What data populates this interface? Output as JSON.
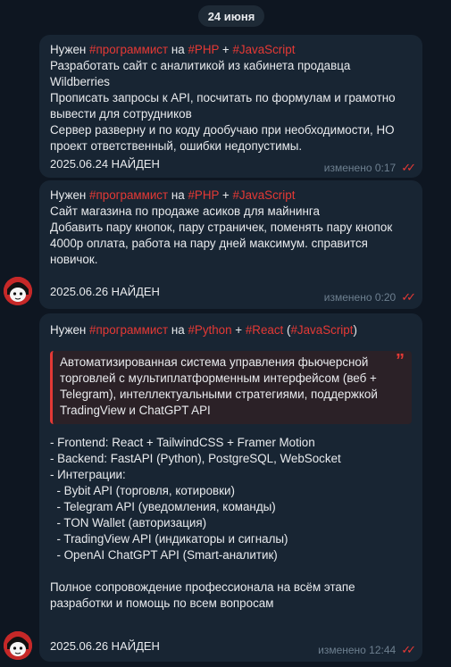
{
  "date_label": "24 июня",
  "messages": [
    {
      "header": {
        "p1": "Нужен ",
        "t1": "#программист",
        "p2": " на ",
        "t2": "#PHP",
        "p3": " + ",
        "t3": "#JavaScript"
      },
      "lines": [
        "Разработать сайт с аналитикой из кабинета продавца Wildberries",
        "Прописать запросы к API, посчитать по формулам и грамотно вывести для сотрудников",
        "Сервер разверну и по коду дообучаю при необходимости, НО проект ответственный, ошибки недопустимы."
      ],
      "found": "2025.06.24 НАЙДЕН",
      "edited": "изменено 0:17"
    },
    {
      "header": {
        "p1": "Нужен ",
        "t1": "#программист",
        "p2": " на ",
        "t2": "#PHP",
        "p3": " + ",
        "t3": "#JavaScript"
      },
      "lines": [
        "Сайт магазина по продаже асиков для майнинга",
        "Добавить пару кнопок, пару страничек, поменять пару кнопок 4000р оплата, работа на пару дней максимум. справится новичок."
      ],
      "found": "2025.06.26 НАЙДЕН",
      "edited": "изменено 0:20"
    },
    {
      "header": {
        "p1": "Нужен ",
        "t1": "#программист",
        "p2": " на ",
        "t2": "#Python",
        "p3": " + ",
        "t3": "#React",
        "p4": " (",
        "t4": "#JavaScript",
        "p5": ")"
      },
      "quote": "Автоматизированная система управления фьючерсной торговлей с мультиплатформенным интерфейсом (веб + Telegram), интеллектуальными стратегиями, поддержкой TradingView и ChatGPT API",
      "lines": [
        "- Frontend: React + TailwindCSS + Framer Motion",
        "- Backend: FastAPI (Python), PostgreSQL, WebSocket",
        "- Интеграции:",
        "  - Bybit API (торговля, котировки)",
        "  - Telegram API (уведомления, команды)",
        "  - TON Wallet (авторизация)",
        "  - TradingView API (индикаторы и сигналы)",
        "  - OpenAI ChatGPT API (Smart-аналитик)"
      ],
      "closing": "Полное сопровождение профессионала на всём этапе разработки и помощь по всем вопросам",
      "found": "2025.06.26 НАЙДЕН",
      "edited": "изменено 12:44"
    }
  ],
  "icons": {
    "read": "double-check-icon",
    "quote": "quote-icon",
    "avatar": "avatar"
  },
  "colors": {
    "background": "#0e1621",
    "bubble": "#182533",
    "accent": "#e53935",
    "meta": "#6d7f8f"
  }
}
